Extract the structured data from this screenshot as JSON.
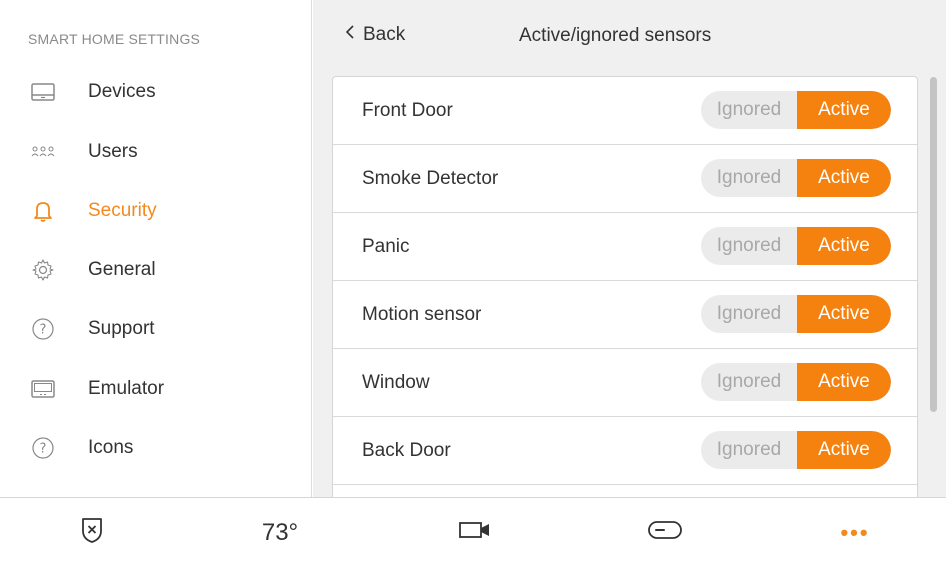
{
  "sidebar": {
    "heading": "SMART HOME SETTINGS",
    "items": [
      {
        "label": "Devices",
        "icon": "monitor-icon"
      },
      {
        "label": "Users",
        "icon": "users-icon"
      },
      {
        "label": "Security",
        "icon": "bell-icon",
        "active": true
      },
      {
        "label": "General",
        "icon": "gear-icon"
      },
      {
        "label": "Support",
        "icon": "question-icon"
      },
      {
        "label": "Emulator",
        "icon": "screen-icon"
      },
      {
        "label": "Icons",
        "icon": "question-icon"
      }
    ]
  },
  "header": {
    "back_label": "Back",
    "title": "Active/ignored sensors"
  },
  "sensors": [
    {
      "name": "Front Door",
      "ignored_label": "Ignored",
      "active_label": "Active",
      "state": "Active"
    },
    {
      "name": "Smoke Detector",
      "ignored_label": "Ignored",
      "active_label": "Active",
      "state": "Active"
    },
    {
      "name": "Panic",
      "ignored_label": "Ignored",
      "active_label": "Active",
      "state": "Active"
    },
    {
      "name": "Motion sensor",
      "ignored_label": "Ignored",
      "active_label": "Active",
      "state": "Active"
    },
    {
      "name": "Window",
      "ignored_label": "Ignored",
      "active_label": "Active",
      "state": "Active"
    },
    {
      "name": "Back Door",
      "ignored_label": "Ignored",
      "active_label": "Active",
      "state": "Active"
    }
  ],
  "bottom_bar": {
    "temperature": "73°",
    "more": "•••",
    "icons": [
      "shield-x-icon",
      "camera-icon",
      "toggle-icon",
      "more-icon"
    ]
  },
  "colors": {
    "accent": "#f5820f",
    "background": "#f0f0f0",
    "toggle_bg": "#ebebeb"
  }
}
